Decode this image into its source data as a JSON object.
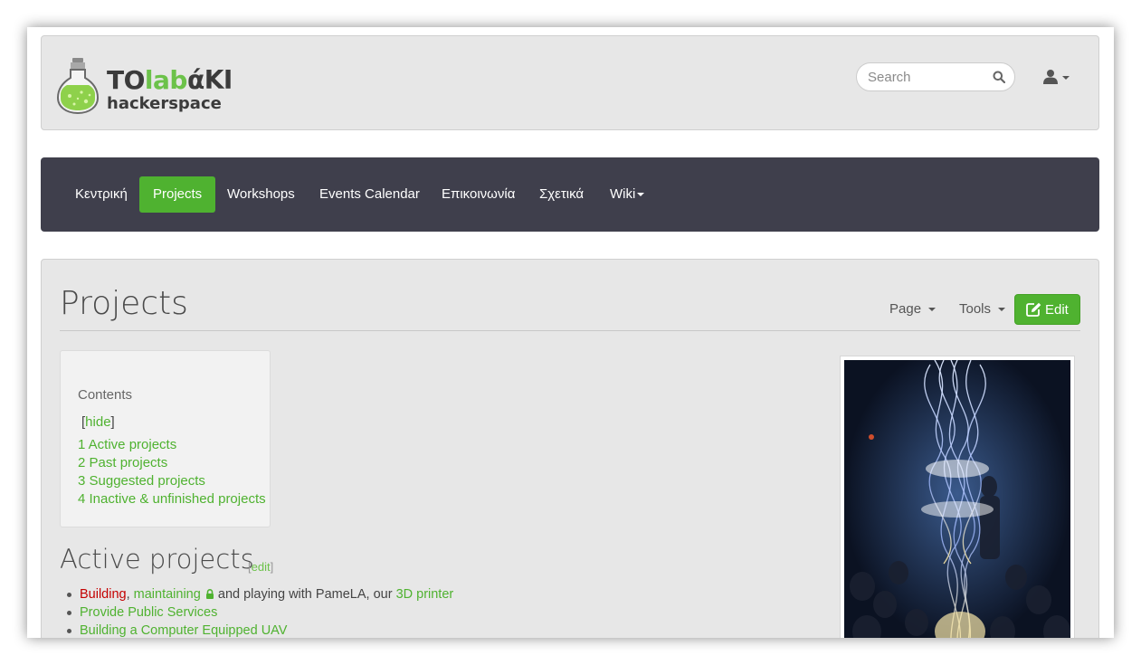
{
  "brand": {
    "logo_part1": "TO",
    "logo_part2": "lab",
    "logo_part3": "άΚΙ",
    "logo_line2": "hackerspace"
  },
  "search": {
    "placeholder": "Search"
  },
  "nav": {
    "items": [
      {
        "label": "Κεντρική"
      },
      {
        "label": "Projects",
        "active": true
      },
      {
        "label": "Workshops"
      },
      {
        "label": "Events Calendar"
      },
      {
        "label": "Επικοινωνία"
      },
      {
        "label": "Σχετικά"
      },
      {
        "label": "Wiki"
      }
    ]
  },
  "page": {
    "title": "Projects",
    "page_menu": "Page",
    "tools_menu": "Tools",
    "edit_label": "Edit"
  },
  "toc": {
    "title": "Contents",
    "hide_open": "[",
    "hide_label": "hide",
    "hide_close": "]",
    "items": [
      {
        "label": "1 Active projects"
      },
      {
        "label": "2 Past projects"
      },
      {
        "label": "3 Suggested projects"
      },
      {
        "label": "4 Inactive & unfinished projects"
      }
    ]
  },
  "section": {
    "heading": "Active projects",
    "edit_open": "[",
    "edit_label": "edit",
    "edit_close": "]",
    "items": [
      {
        "part1": "Building",
        "sep1": ", ",
        "part2": "maintaining",
        "part3": " and playing with PameLA, our ",
        "part4": "3D printer"
      },
      {
        "label": "Provide Public Services"
      },
      {
        "label": "Building a Computer Equipped UAV"
      }
    ]
  },
  "colors": {
    "accent": "#4fb230",
    "navbar": "#3f3f4c",
    "panel": "#e7e7e7",
    "redlink": "#c40000"
  },
  "icons": {
    "search": "search-icon",
    "user": "user-icon",
    "edit": "pencil-square-icon",
    "lock": "lock-icon"
  }
}
